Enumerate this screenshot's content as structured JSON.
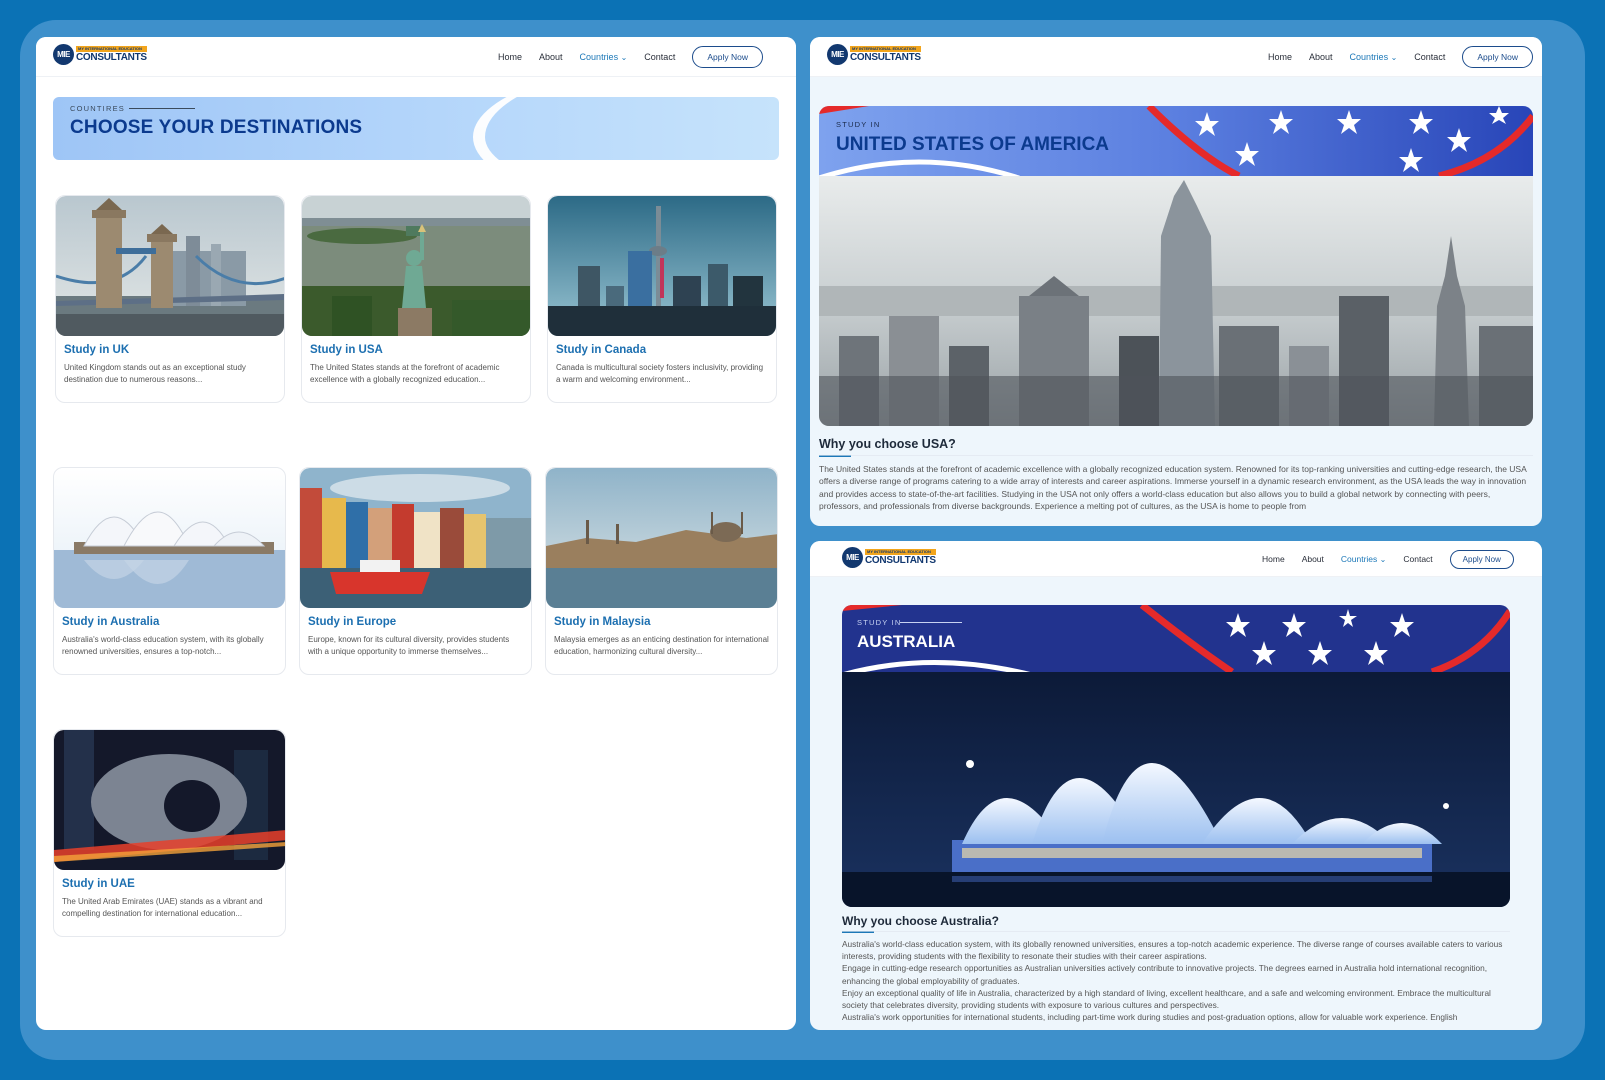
{
  "nav": {
    "logo_mark": "MIE",
    "logo_top": "MY INTERNATIONAL EDUCATION",
    "logo_bottom": "CONSULTANTS",
    "items": [
      "Home",
      "About",
      "Countries",
      "Contact"
    ],
    "countries_chevron": "⌄",
    "apply": "Apply Now"
  },
  "listing": {
    "eyebrow": "COUNTIRES",
    "title": "CHOOSE YOUR DESTINATIONS",
    "cards": [
      {
        "title": "Study in UK",
        "desc": "United Kingdom stands out as an exceptional study destination due to numerous reasons..."
      },
      {
        "title": "Study in USA",
        "desc": "The United States stands at the forefront of academic excellence with a globally recognized education..."
      },
      {
        "title": "Study in Canada",
        "desc": "Canada is multicultural society fosters inclusivity, providing a warm and welcoming environment..."
      },
      {
        "title": "Study in Australia",
        "desc": "Australia's world-class education system, with its globally renowned universities, ensures a top-notch..."
      },
      {
        "title": "Study in Europe",
        "desc": "Europe, known for its cultural diversity, provides students with a unique opportunity to immerse themselves..."
      },
      {
        "title": "Study in Malaysia",
        "desc": "Malaysia emerges as an enticing destination for international education, harmonizing cultural diversity..."
      },
      {
        "title": "Study in UAE",
        "desc": "The United Arab Emirates (UAE) stands as a vibrant and compelling destination for international education..."
      }
    ]
  },
  "usa": {
    "eyebrow": "STUDY IN",
    "title": "UNITED STATES OF AMERICA",
    "heading": "Why you choose USA?",
    "text": "The United States stands at the forefront of academic excellence with a globally recognized education system. Renowned for its top-ranking universities and cutting-edge research, the USA offers a diverse range of programs catering to a wide array of interests and career aspirations. Immerse yourself in a dynamic research environment, as the USA leads the way in innovation and provides access to state-of-the-art facilities. Studying in the USA not only offers a world-class education but also allows you to build a global network by connecting with peers, professors, and professionals from diverse backgrounds. Experience a melting pot of cultures, as the USA is home to people from"
  },
  "australia": {
    "eyebrow": "STUDY IN",
    "title": "AUSTRALIA",
    "heading": "Why you choose Australia?",
    "paragraphs": [
      "Australia's world-class education system, with its globally renowned universities, ensures a top-notch academic experience. The diverse range of courses available caters to various interests, providing students with the flexibility to resonate their studies with their career aspirations.",
      "Engage in cutting-edge research opportunities as Australian universities actively contribute to innovative projects. The degrees earned in Australia hold international recognition, enhancing the global employability of graduates.",
      "Enjoy an exceptional quality of life in Australia, characterized by a high standard of living, excellent healthcare, and a safe and welcoming environment. Embrace the multicultural society that celebrates diversity, providing students with exposure to various cultures and perspectives.",
      "Australia's work opportunities for international students, including part-time work during studies and post-graduation options, allow for valuable work experience. English"
    ]
  },
  "colors": {
    "background": "#0b72b5",
    "frame": "#3e90cb",
    "accent": "#1c78b8",
    "title_navy": "#0b3a8e",
    "flag_red": "#e52a2a"
  },
  "icons": [
    "logo-icon",
    "chevron-down-icon",
    "star-icon"
  ]
}
